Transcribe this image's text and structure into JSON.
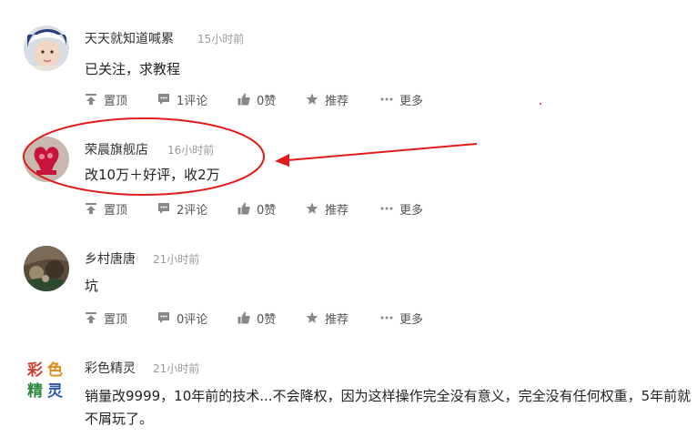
{
  "comments": [
    {
      "name": "天天就知道喊累",
      "time": "15小时前",
      "text": "已关注，求教程",
      "actions": {
        "top": "置顶",
        "comment": "1评论",
        "like": "0赞",
        "recommend": "推荐",
        "more": "更多"
      }
    },
    {
      "name": "荣晨旗舰店",
      "time": "16小时前",
      "text": "改10万＋好评，收2万",
      "actions": {
        "top": "置顶",
        "comment": "2评论",
        "like": "0赞",
        "recommend": "推荐",
        "more": "更多"
      }
    },
    {
      "name": "乡村唐唐",
      "time": "21小时前",
      "text": "坑",
      "actions": {
        "top": "置顶",
        "comment": "0评论",
        "like": "0赞",
        "recommend": "推荐",
        "more": "更多"
      }
    },
    {
      "name": "彩色精灵",
      "time": "21小时前",
      "text": "销量改9999，10年前的技术...不会降权，因为这样操作完全没有意义，完全没有任何权重，5年前就不屑玩了。",
      "logo_chars": [
        "彩",
        "色",
        "精",
        "灵"
      ]
    }
  ],
  "colors": {
    "annotation": "#e01b1b",
    "icon": "#888888",
    "time": "#999999"
  },
  "icons": [
    "pin-top-icon",
    "comment-bubble-icon",
    "thumbs-up-icon",
    "star-icon",
    "more-dots-icon"
  ]
}
